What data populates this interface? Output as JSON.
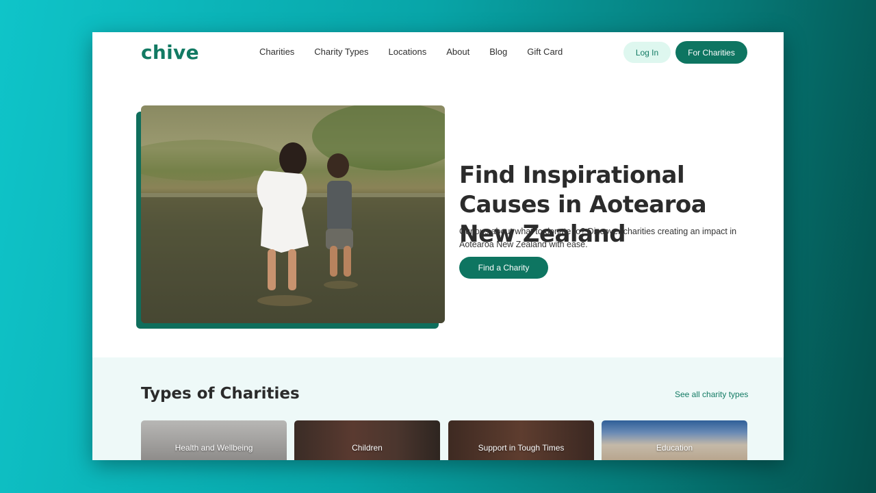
{
  "nav": {
    "logo": "chive",
    "items": [
      "Charities",
      "Charity Types",
      "Locations",
      "About",
      "Blog",
      "Gift Card"
    ],
    "login_label": "Log In",
    "for_charities_label": "For Charities"
  },
  "hero": {
    "title": "Find Inspirational Causes in Aotearoa New Zealand",
    "subtitle": "Curious about what to donate to? Discover charities creating an impact in Aotearoa New Zealand with ease.",
    "cta_label": "Find a Charity"
  },
  "types": {
    "title": "Types of Charities",
    "see_all_label": "See all charity types",
    "cards": [
      "Health and Wellbeing",
      "Children",
      "Support in Tough Times",
      "Education"
    ]
  },
  "colors": {
    "brand": "#0e7561",
    "brand_light": "#def7ef",
    "section_bg": "#eef9f8"
  }
}
